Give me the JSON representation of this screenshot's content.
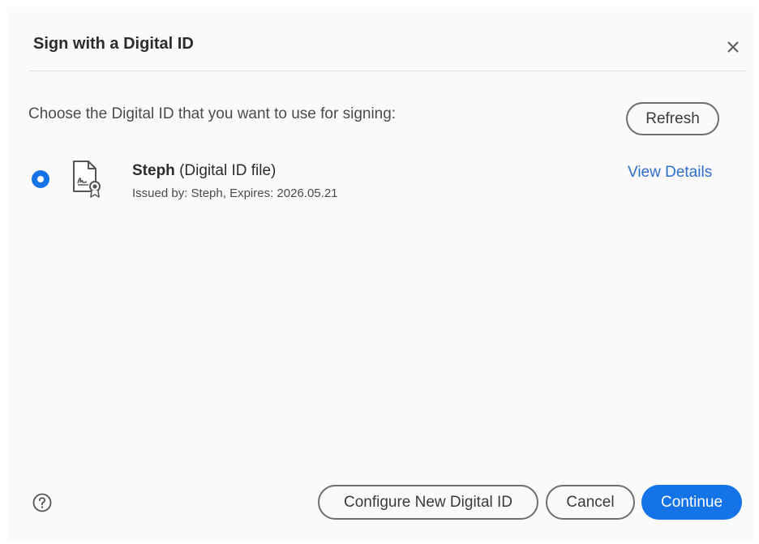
{
  "dialog": {
    "title": "Sign with a Digital ID",
    "close_icon": "close-icon"
  },
  "prompt": "Choose the Digital ID that you want to use for signing:",
  "refresh_label": "Refresh",
  "digital_id": {
    "name": "Steph",
    "type": "(Digital ID file)",
    "issued": "Issued by: Steph, Expires: 2026.05.21",
    "selected": true,
    "icon": "certificate-file-icon"
  },
  "view_details_label": "View Details",
  "footer": {
    "help_icon": "help-icon",
    "configure_label": "Configure New Digital ID",
    "cancel_label": "Cancel",
    "continue_label": "Continue"
  },
  "colors": {
    "accent": "#1473e6",
    "link": "#2d6ec9",
    "background": "#fafafa"
  }
}
